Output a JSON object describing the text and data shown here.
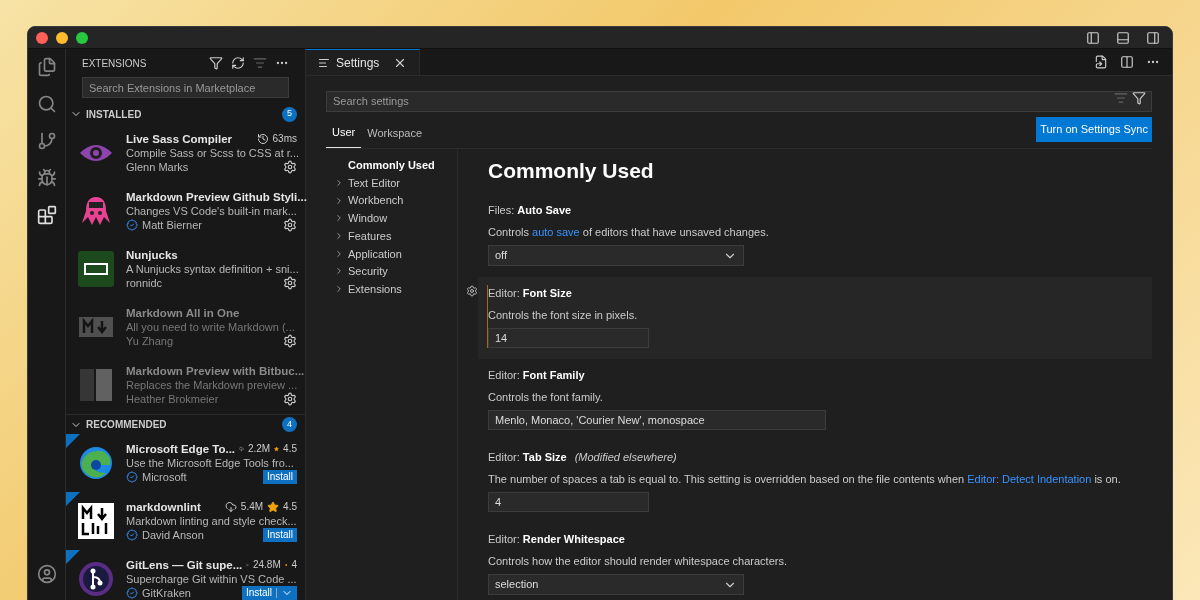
{
  "sidebar": {
    "title": "EXTENSIONS",
    "search": {
      "placeholder": "Search Extensions in Marketplace"
    },
    "sections": [
      {
        "title": "INSTALLED",
        "expanded": true,
        "count": "5",
        "items": [
          {
            "name": "Live Sass Compiler",
            "description": "Compile Sass or Scss to CSS at r...",
            "author": "Glenn Marks",
            "verified": false,
            "timing": "63ms",
            "disabled": false
          },
          {
            "name": "Markdown Preview Github Styli...",
            "description": "Changes VS Code's built-in mark...",
            "author": "Matt Bierner",
            "verified": true,
            "disabled": false
          },
          {
            "name": "Nunjucks",
            "description": "A Nunjucks syntax definition + sni...",
            "author": "ronnidc",
            "verified": false,
            "disabled": false
          },
          {
            "name": "Markdown All in One",
            "description": "All you need to write Markdown (...",
            "author": "Yu Zhang",
            "verified": false,
            "disabled": true
          },
          {
            "name": "Markdown Preview with Bitbuc...",
            "description": "Replaces the Markdown preview ...",
            "author": "Heather Brokmeier",
            "verified": false,
            "disabled": true
          }
        ]
      },
      {
        "title": "RECOMMENDED",
        "expanded": true,
        "count": "4",
        "items": [
          {
            "name": "Microsoft Edge To...",
            "description": "Use the Microsoft Edge Tools fro...",
            "author": "Microsoft",
            "verified": true,
            "downloads": "2.2M",
            "rating": "4.5",
            "install": "Install",
            "split": false,
            "disabled": false
          },
          {
            "name": "markdownlint",
            "description": "Markdown linting and style check...",
            "author": "David Anson",
            "verified": true,
            "downloads": "5.4M",
            "rating": "4.5",
            "install": "Install",
            "split": false,
            "disabled": false
          },
          {
            "name": "GitLens — Git supe...",
            "description": "Supercharge Git within VS Code ...",
            "author": "GitKraken",
            "verified": true,
            "downloads": "24.8M",
            "rating": "4",
            "install": "Install",
            "split": true,
            "disabled": false
          }
        ]
      }
    ]
  },
  "editor": {
    "tab": {
      "label": "Settings",
      "selected": true
    },
    "search": {
      "placeholder": "Search settings"
    },
    "scope_tabs": [
      {
        "label": "User",
        "selected": true
      },
      {
        "label": "Workspace",
        "selected": false
      }
    ],
    "sync_button": "Turn on Settings Sync",
    "toc": [
      {
        "label": "Commonly Used",
        "selected": true,
        "expandable": false
      },
      {
        "label": "Text Editor",
        "selected": false,
        "expandable": true
      },
      {
        "label": "Workbench",
        "selected": false,
        "expandable": true
      },
      {
        "label": "Window",
        "selected": false,
        "expandable": true
      },
      {
        "label": "Features",
        "selected": false,
        "expandable": true
      },
      {
        "label": "Application",
        "selected": false,
        "expandable": true
      },
      {
        "label": "Security",
        "selected": false,
        "expandable": true
      },
      {
        "label": "Extensions",
        "selected": false,
        "expandable": true
      }
    ],
    "heading": "Commonly Used",
    "settings": [
      {
        "category": "Files:",
        "name": "Auto Save",
        "focused": false,
        "description": [
          {
            "kind": "text",
            "text": "Controls"
          },
          {
            "kind": "link",
            "text": "auto save"
          },
          {
            "kind": "text",
            "text": "of editors that have unsaved changes."
          }
        ],
        "control": {
          "kind": "select",
          "value": "off"
        }
      },
      {
        "category": "Editor:",
        "name": "Font Size",
        "focused": true,
        "description": [
          {
            "kind": "text",
            "text": "Controls the font size in pixels."
          }
        ],
        "control": {
          "kind": "input",
          "value": "14"
        }
      },
      {
        "category": "Editor:",
        "name": "Font Family",
        "focused": false,
        "description": [
          {
            "kind": "text",
            "text": "Controls the font family."
          }
        ],
        "control": {
          "kind": "wide-input",
          "value": "Menlo, Monaco, 'Courier New', monospace"
        }
      },
      {
        "category": "Editor:",
        "name": "Tab Size",
        "note": "(Modified elsewhere)",
        "focused": false,
        "description": [
          {
            "kind": "text",
            "text": "The number of spaces a tab is equal to. This setting is overridden based on the file contents when"
          },
          {
            "kind": "link",
            "text": "Editor: Detect Indentation"
          },
          {
            "kind": "text",
            "text": "is on."
          }
        ],
        "control": {
          "kind": "input",
          "value": "4"
        }
      },
      {
        "category": "Editor:",
        "name": "Render Whitespace",
        "focused": false,
        "description": [
          {
            "kind": "text",
            "text": "Controls how the editor should render whitespace characters."
          }
        ],
        "control": {
          "kind": "select",
          "value": "selection"
        }
      }
    ]
  }
}
